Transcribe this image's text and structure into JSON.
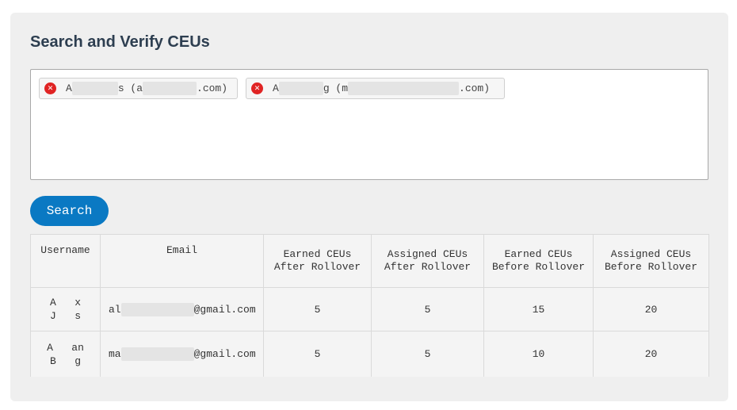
{
  "page": {
    "title": "Search and Verify CEUs"
  },
  "selected_users": [
    {
      "prefix": "A",
      "middle": "s (a",
      "suffix": ".com)"
    },
    {
      "prefix": "A",
      "middle": "g (m",
      "suffix": ".com)"
    }
  ],
  "search_button": {
    "label": "Search"
  },
  "table": {
    "headers": [
      "Username",
      "Email",
      "Earned CEUs\nAfter Rollover",
      "Assigned CEUs\nAfter Rollover",
      "Earned CEUs\nBefore Rollover",
      "Assigned CEUs\nBefore Rollover"
    ],
    "rows": [
      {
        "username_line1": "A   x",
        "username_line2": "J   s",
        "email_prefix": "al",
        "email_suffix": "@gmail.com",
        "earned_after": "5",
        "assigned_after": "5",
        "earned_before": "15",
        "assigned_before": "20"
      },
      {
        "username_line1": "A   an",
        "username_line2": "B   g",
        "email_prefix": "ma",
        "email_suffix": "@gmail.com",
        "earned_after": "5",
        "assigned_after": "5",
        "earned_before": "10",
        "assigned_before": "20"
      }
    ]
  }
}
